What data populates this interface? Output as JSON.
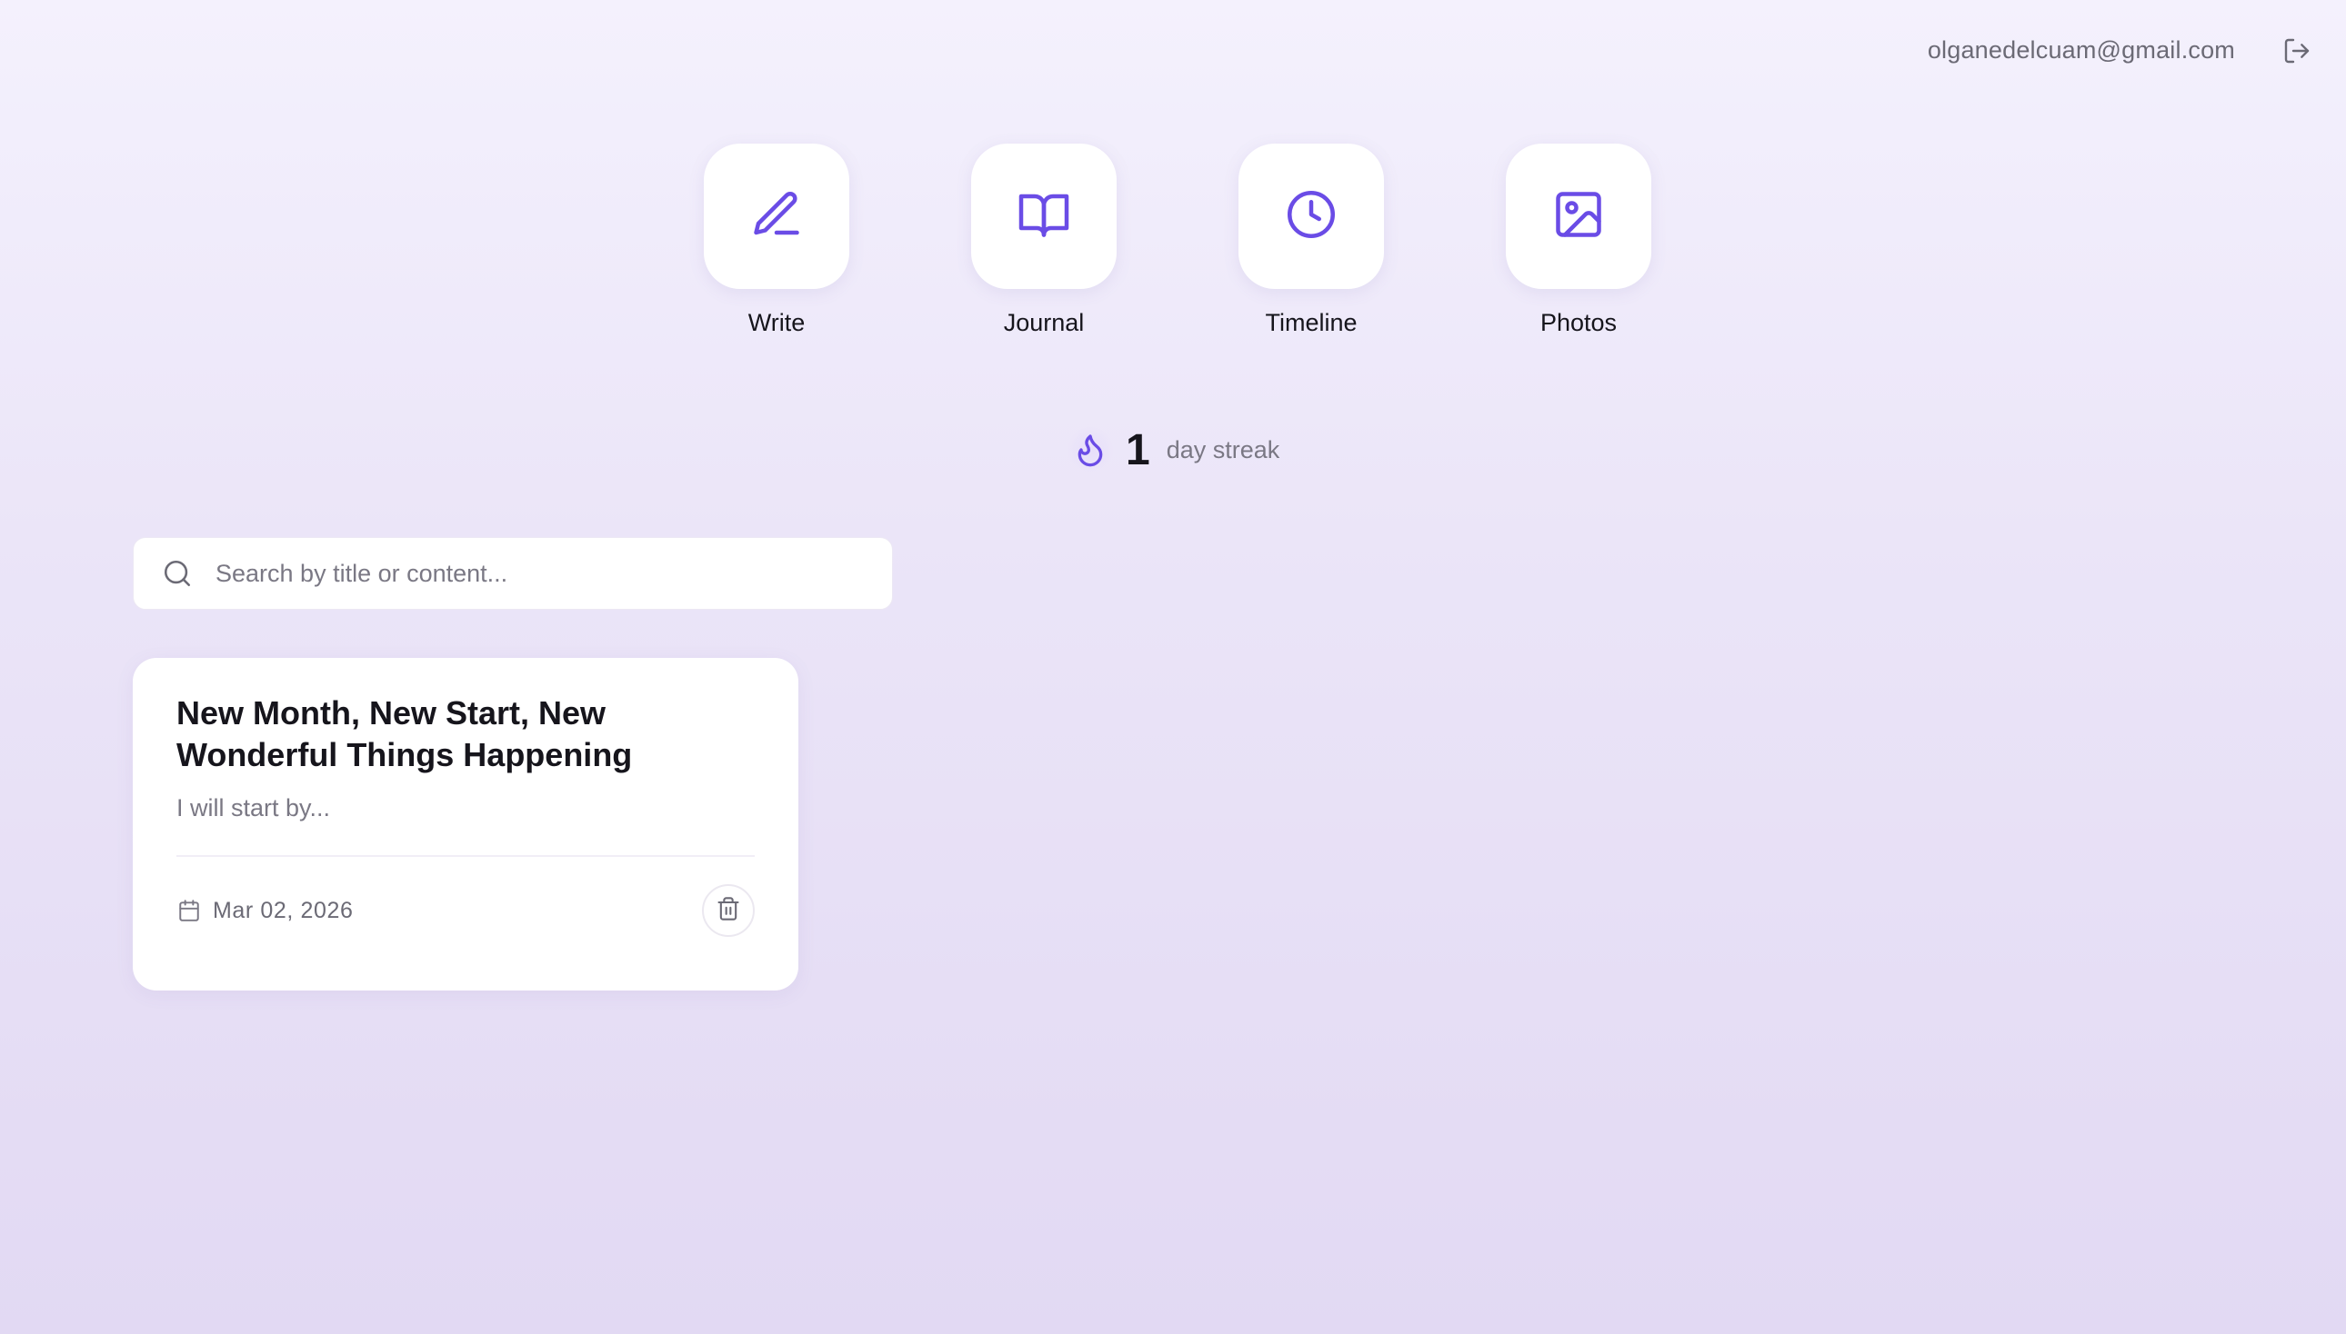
{
  "header": {
    "user_email": "olganedelcuam@gmail.com",
    "logout_icon": "logout-icon"
  },
  "nav": {
    "items": [
      {
        "label": "Write",
        "icon": "pencil-icon"
      },
      {
        "label": "Journal",
        "icon": "book-open-icon"
      },
      {
        "label": "Timeline",
        "icon": "clock-icon"
      },
      {
        "label": "Photos",
        "icon": "image-icon"
      }
    ]
  },
  "streak": {
    "count": "1",
    "label": "day streak",
    "icon": "flame-icon"
  },
  "search": {
    "placeholder": "Search by title or content...",
    "value": ""
  },
  "entries": [
    {
      "title": "New Month, New Start, New Wonderful Things Happening",
      "excerpt": "I will start by...",
      "date": "Mar 02, 2026"
    }
  ],
  "colors": {
    "accent": "#6a4ce6",
    "background_top": "#f4f1fd",
    "background_bottom": "#e2d9f3",
    "text_primary": "#16151c",
    "text_secondary": "#7a7884"
  }
}
